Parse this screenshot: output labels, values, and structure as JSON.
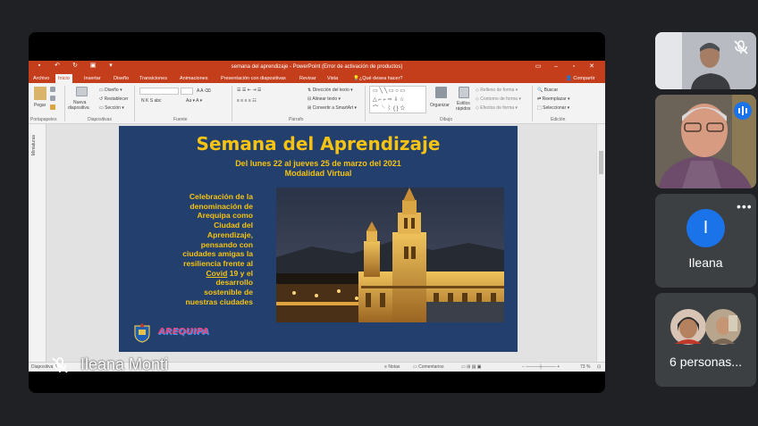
{
  "colors": {
    "ppt_accent": "#c43e1c",
    "slide_bg": "#223f6e",
    "slide_text": "#f6c312",
    "meet_bg": "#202124",
    "tile_bg": "#3c4043",
    "avatar_blue": "#1a73e8"
  },
  "ppt": {
    "window_title": "semana del aprendizaje - PowerPoint (Error de activación de productos)",
    "tabs": [
      "Archivo",
      "Inicio",
      "Insertar",
      "Diseño",
      "Transiciones",
      "Animaciones",
      "Presentación con diapositivas",
      "Revisar",
      "Vista",
      "¿Qué desea hacer?"
    ],
    "share": "Compartir",
    "ribbon": {
      "paste": "Pegar",
      "new_slide_1": "Nueva",
      "new_slide_2": "diapositiva",
      "layout": "Diseño",
      "reset": "Restablecer",
      "section": "Sección",
      "text_direction": "Dirección del texto",
      "align_text": "Alinear texto",
      "smartart": "Convertir a SmartArt",
      "arrange": "Organizar",
      "quick_styles_1": "Estilos",
      "quick_styles_2": "rápidos",
      "shape_fill": "Relleno de forma",
      "shape_outline": "Contorno de forma",
      "shape_effects": "Efectos de forma",
      "find": "Buscar",
      "replace": "Reemplazar",
      "select": "Seleccionar",
      "font_btns": "N  K  S  abc",
      "groups": [
        "Portapapeles",
        "Diapositivas",
        "Fuente",
        "Párrafo",
        "Dibujo",
        "Edición"
      ]
    },
    "thumbnails_label": "Miniaturas",
    "status": {
      "slide": "Diapositiva 8",
      "notes": "Notas",
      "comments": "Comentarios",
      "zoom": "73 %"
    }
  },
  "slide": {
    "title": "Semana del Aprendizaje",
    "subtitle1": "Del lunes 22 al jueves 25 de marzo del 2021",
    "subtitle2": "Modalidad Virtual",
    "body_lines": [
      "Celebración de la",
      "denominación de",
      "Arequipa como",
      "Ciudad del",
      "Aprendizaje,",
      "pensando con",
      "ciudades amigas la",
      "resiliencia frente al"
    ],
    "covid_word": "Covid",
    "covid_rest": " 19 y el",
    "body_tail": [
      "desarrollo",
      "sostenible de",
      "nuestras ciudades"
    ],
    "logo_text": "AREQUIPA"
  },
  "meet": {
    "presenter_name": "Ileana Monti",
    "participant_initial": "I",
    "participant_name": "Ileana",
    "others_label": "6 personas..."
  }
}
